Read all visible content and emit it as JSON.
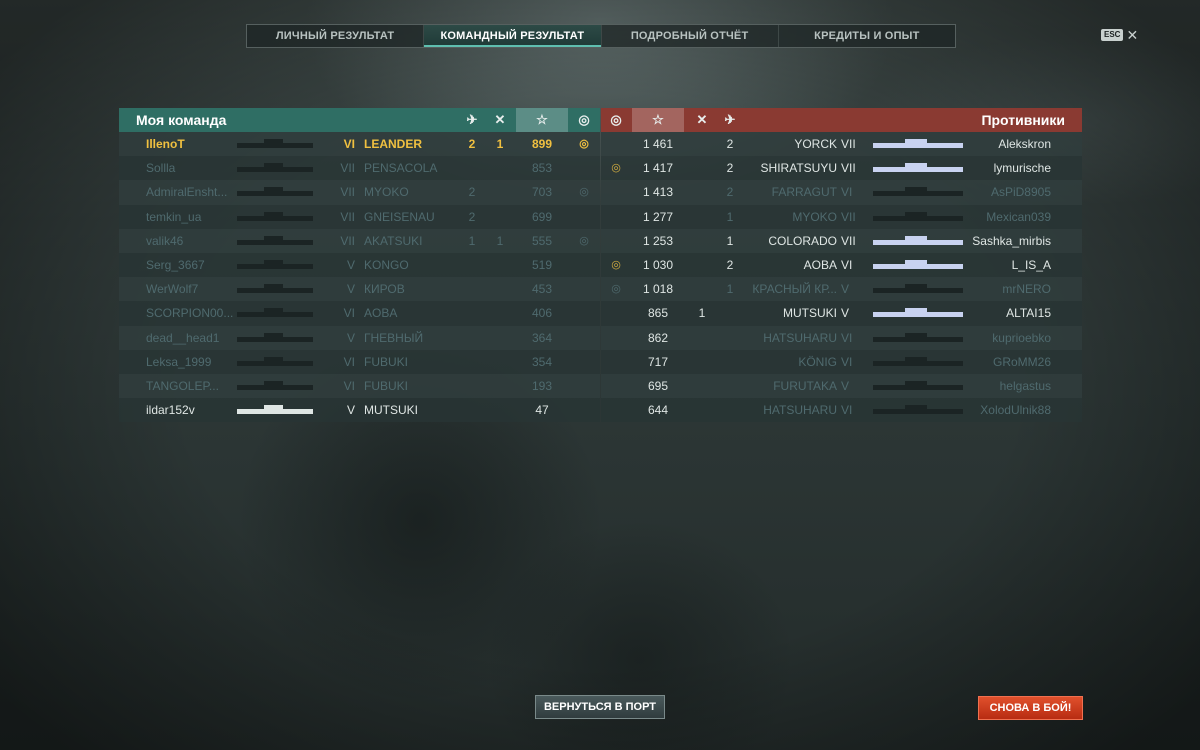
{
  "tabs": [
    {
      "label": "ЛИЧНЫЙ РЕЗУЛЬТАТ",
      "active": false
    },
    {
      "label": "КОМАНДНЫЙ РЕЗУЛЬТАТ",
      "active": true
    },
    {
      "label": "ПОДРОБНЫЙ ОТЧЁТ",
      "active": false
    },
    {
      "label": "КРЕДИТЫ И ОПЫТ",
      "active": false
    }
  ],
  "esc_label": "ESC",
  "close_glyph": "✕",
  "my_team": {
    "title": "Моя команда",
    "accent_color": "#2f6e64",
    "columns": {
      "planes_icon": "plane-icon",
      "kills_icon": "crossed-swords-icon",
      "xp_icon": "star-icon",
      "medal_icon": "medal-icon"
    },
    "star_glyph": "☆",
    "rows": [
      {
        "player": "IllenoT",
        "tier": "VI",
        "ship": "LEANDER",
        "planes": "2",
        "kills": "1",
        "xp": "899",
        "medal": true,
        "state": "highlight"
      },
      {
        "player": "Sollla",
        "tier": "VII",
        "ship": "PENSACOLA",
        "planes": "",
        "kills": "",
        "xp": "853",
        "medal": false,
        "state": "dim"
      },
      {
        "player": "AdmiralEnsht...",
        "tier": "VII",
        "ship": "MYOKO",
        "planes": "2",
        "kills": "",
        "xp": "703",
        "medal": true,
        "state": "dim"
      },
      {
        "player": "temkin_ua",
        "tier": "VII",
        "ship": "GNEISENAU",
        "planes": "2",
        "kills": "",
        "xp": "699",
        "medal": false,
        "state": "dim"
      },
      {
        "player": "valik46",
        "tier": "VII",
        "ship": "AKATSUKI",
        "planes": "1",
        "kills": "1",
        "xp": "555",
        "medal": true,
        "state": "dim"
      },
      {
        "player": "Serg_3667",
        "tier": "V",
        "ship": "KONGO",
        "planes": "",
        "kills": "",
        "xp": "519",
        "medal": false,
        "state": "dim"
      },
      {
        "player": "WerWolf7",
        "tier": "V",
        "ship": "КИРОВ",
        "planes": "",
        "kills": "",
        "xp": "453",
        "medal": false,
        "state": "dim"
      },
      {
        "player": "SCORPION00...",
        "tier": "VI",
        "ship": "AOBA",
        "planes": "",
        "kills": "",
        "xp": "406",
        "medal": false,
        "state": "dim"
      },
      {
        "player": "dead__head1",
        "tier": "V",
        "ship": "ГНЕВНЫЙ",
        "planes": "",
        "kills": "",
        "xp": "364",
        "medal": false,
        "state": "dim"
      },
      {
        "player": "Leksa_1999",
        "tier": "VI",
        "ship": "FUBUKI",
        "planes": "",
        "kills": "",
        "xp": "354",
        "medal": false,
        "state": "dim"
      },
      {
        "player": "TANGOLEP...",
        "tier": "VI",
        "ship": "FUBUKI",
        "planes": "",
        "kills": "",
        "xp": "193",
        "medal": false,
        "state": "dim"
      },
      {
        "player": "ildar152v",
        "tier": "V",
        "ship": "MUTSUKI",
        "planes": "",
        "kills": "",
        "xp": "47",
        "medal": false,
        "state": "alive"
      }
    ]
  },
  "enemy_team": {
    "title": "Противники",
    "accent_color": "#8a3a32",
    "star_glyph": "☆",
    "rows": [
      {
        "player": "Alekskron",
        "tier": "VII",
        "ship": "YORCK",
        "planes": "",
        "kills": "2",
        "xp": "1 461",
        "medal": false,
        "state": "alive"
      },
      {
        "player": "lymurische",
        "tier": "VII",
        "ship": "SHIRATSUYU",
        "planes": "",
        "kills": "2",
        "xp": "1 417",
        "medal": true,
        "state": "alive"
      },
      {
        "player": "AsPiD8905",
        "tier": "VI",
        "ship": "FARRAGUT",
        "planes": "",
        "kills": "2",
        "xp": "1 413",
        "medal": false,
        "state": "dim"
      },
      {
        "player": "Mexican039",
        "tier": "VII",
        "ship": "MYOKO",
        "planes": "",
        "kills": "1",
        "xp": "1 277",
        "medal": false,
        "state": "dim"
      },
      {
        "player": "Sashka_mirbis",
        "tier": "VII",
        "ship": "COLORADO",
        "planes": "",
        "kills": "1",
        "xp": "1 253",
        "medal": false,
        "state": "alive"
      },
      {
        "player": "L_IS_A",
        "tier": "VI",
        "ship": "AOBA",
        "planes": "",
        "kills": "2",
        "xp": "1 030",
        "medal": true,
        "state": "alive"
      },
      {
        "player": "mrNERO",
        "tier": "V",
        "ship": "КРАСНЫЙ КР...",
        "planes": "",
        "kills": "1",
        "xp": "1 018",
        "medal": true,
        "state": "dim"
      },
      {
        "player": "ALTAI15",
        "tier": "V",
        "ship": "MUTSUKI",
        "planes": "1",
        "kills": "",
        "xp": "865",
        "medal": false,
        "state": "alive"
      },
      {
        "player": "kuprioebko",
        "tier": "VI",
        "ship": "HATSUHARU",
        "planes": "",
        "kills": "",
        "xp": "862",
        "medal": false,
        "state": "dim"
      },
      {
        "player": "GRoMM26",
        "tier": "VI",
        "ship": "KÖNIG",
        "planes": "",
        "kills": "",
        "xp": "717",
        "medal": false,
        "state": "dim"
      },
      {
        "player": "helgastus",
        "tier": "V",
        "ship": "FURUTAKA",
        "planes": "",
        "kills": "",
        "xp": "695",
        "medal": false,
        "state": "dim"
      },
      {
        "player": "XolodUlnik88",
        "tier": "VI",
        "ship": "HATSUHARU",
        "planes": "",
        "kills": "",
        "xp": "644",
        "medal": false,
        "state": "dim"
      }
    ]
  },
  "buttons": {
    "return_to_port": "ВЕРНУТЬСЯ В ПОРТ",
    "battle_again": "СНОВА В БОЙ!"
  }
}
